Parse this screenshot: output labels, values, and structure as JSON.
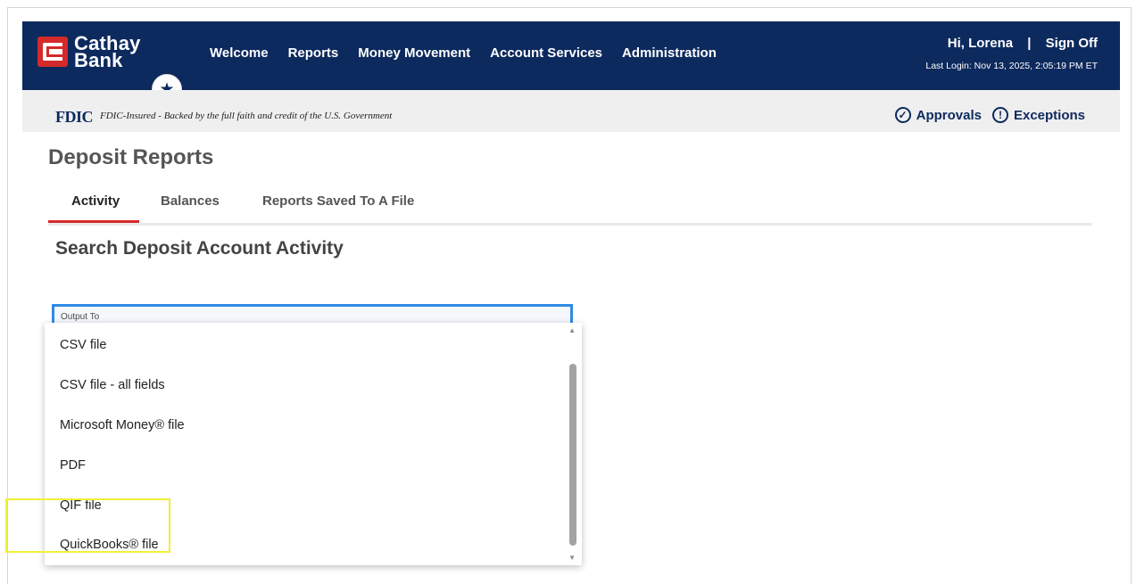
{
  "header": {
    "logo_line1": "Cathay",
    "logo_line2": "Bank",
    "nav": [
      "Welcome",
      "Reports",
      "Money Movement",
      "Account Services",
      "Administration"
    ],
    "greeting": "Hi, Lorena",
    "separator": "|",
    "sign_off": "Sign Off",
    "last_login": "Last Login: Nov 13, 2025, 2:05:19 PM ET"
  },
  "fdic": {
    "logo": "FDIC",
    "text": "FDIC-Insured - Backed by the full faith and credit of the U.S. Government"
  },
  "actions": {
    "approvals": "Approvals",
    "exceptions": "Exceptions"
  },
  "page": {
    "title": "Deposit Reports",
    "tabs": [
      "Activity",
      "Balances",
      "Reports Saved To A File"
    ],
    "active_tab": "Activity",
    "section_title": "Search Deposit Account Activity"
  },
  "output_field": {
    "label": "Output To",
    "options": [
      "CSV file",
      "CSV file - all fields",
      "Microsoft Money® file",
      "PDF",
      "QIF file",
      "QuickBooks® file"
    ]
  },
  "icons": {
    "favorite": "star-icon",
    "approvals": "check-circle-icon",
    "exceptions": "exclamation-circle-icon"
  },
  "colors": {
    "brand_navy": "#0d2a5e",
    "brand_red": "#d42a2a",
    "focus_blue": "#2f8ae6",
    "highlight_yellow": "#f0f039"
  }
}
